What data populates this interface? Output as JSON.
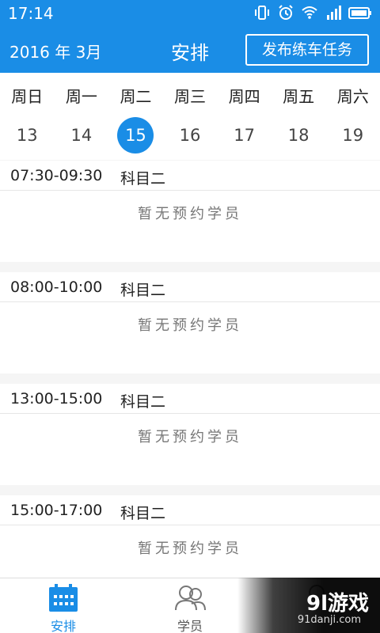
{
  "status_bar": {
    "time": "17:14"
  },
  "header": {
    "date": "2016 年 3月",
    "title": "安排",
    "publish_button": "发布练车任务"
  },
  "week": {
    "days": [
      "周日",
      "周一",
      "周二",
      "周三",
      "周四",
      "周五",
      "周六"
    ],
    "dates": [
      "13",
      "14",
      "15",
      "16",
      "17",
      "18",
      "19"
    ],
    "selected": "15"
  },
  "slots": [
    {
      "time": "07:30-09:30",
      "subject": "科目二",
      "empty_text": "暂无预约学员"
    },
    {
      "time": "08:00-10:00",
      "subject": "科目二",
      "empty_text": "暂无预约学员"
    },
    {
      "time": "13:00-15:00",
      "subject": "科目二",
      "empty_text": "暂无预约学员"
    },
    {
      "time": "15:00-17:00",
      "subject": "科目二",
      "empty_text": "暂无预约学员"
    }
  ],
  "tabs": [
    {
      "label": "安排",
      "icon": "calendar-icon",
      "active": true
    },
    {
      "label": "学员",
      "icon": "students-icon",
      "active": false
    },
    {
      "label": "",
      "icon": "profile-icon",
      "active": false
    }
  ],
  "watermark": {
    "main": "9l游戏",
    "sub": "91danji.com"
  },
  "colors": {
    "accent": "#1a8de6"
  }
}
